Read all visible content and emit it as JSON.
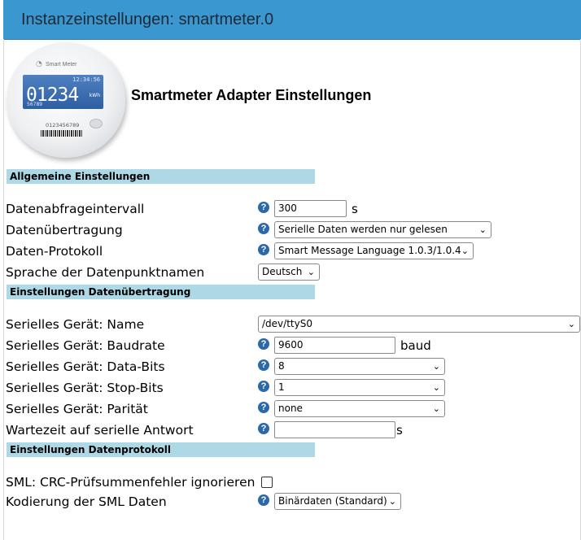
{
  "window": {
    "title": "Instanzeinstellungen: smartmeter.0"
  },
  "meter_image": {
    "brand": "Smart Meter",
    "clock": "12:34:56",
    "reading": "01234",
    "unit": "kWh",
    "small_number": "56789",
    "serial": "0123456789"
  },
  "page_heading": "Smartmeter Adapter Einstellungen",
  "sections": {
    "general": "Allgemeine Einstellungen",
    "transfer": "Einstellungen Datenübertragung",
    "protocol": "Einstellungen Datenprotokoll"
  },
  "general": {
    "interval_label": "Datenabfrageintervall",
    "interval_value": "300",
    "interval_unit": "s",
    "transfer_label": "Datenübertragung",
    "transfer_value": "Serielle Daten werden nur gelesen",
    "protocol_label": "Daten-Protokoll",
    "protocol_value": "Smart Message Language 1.0.3/1.0.4",
    "language_label": "Sprache der Datenpunktnamen",
    "language_value": "Deutsch"
  },
  "transfer": {
    "name_label": "Serielles Gerät: Name",
    "name_value": "/dev/ttyS0",
    "baud_label": "Serielles Gerät: Baudrate",
    "baud_value": "9600",
    "baud_unit": "baud",
    "databits_label": "Serielles Gerät: Data-Bits",
    "databits_value": "8",
    "stopbits_label": "Serielles Gerät: Stop-Bits",
    "stopbits_value": "1",
    "parity_label": "Serielles Gerät: Parität",
    "parity_value": "none",
    "wait_label": "Wartezeit auf serielle Antwort",
    "wait_value": "",
    "wait_unit": "s"
  },
  "protocol": {
    "crc_label": "SML: CRC-Prüfsummenfehler ignorieren",
    "crc_checked": false,
    "encoding_label": "Kodierung der SML Daten",
    "encoding_value": "Binärdaten (Standard)"
  },
  "icons": {
    "help": "help-icon",
    "chevron": "chevron-down-icon"
  },
  "colors": {
    "titlebar": "#3a97cf",
    "section": "#add8e6",
    "help": "#2c69a8"
  }
}
